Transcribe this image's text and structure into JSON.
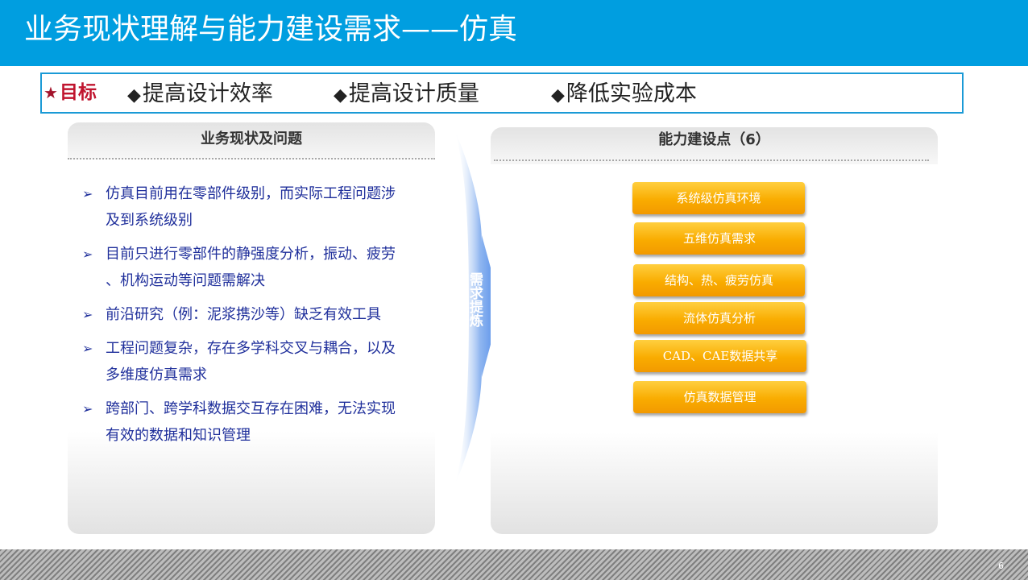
{
  "slide": {
    "title": "业务现状理解与能力建设需求——仿真",
    "page_number": "6"
  },
  "goals": {
    "label": "目标",
    "items": [
      "提高设计效率",
      "提高设计质量",
      "降低实验成本"
    ]
  },
  "left_panel": {
    "title": "业务现状及问题",
    "issues": [
      [
        "仿真目前用在零部件级别，而实际工程问题涉",
        "及到系统级别"
      ],
      [
        "目前只进行零部件的静强度分析，振动、疲劳",
        "、机构运动等问题需解决"
      ],
      [
        "前沿研究（例：泥浆携沙等）缺乏有效工具"
      ],
      [
        "工程问题复杂，存在多学科交叉与耦合，以及",
        "多维度仿真需求"
      ],
      [
        "跨部门、跨学科数据交互存在困难，无法实现",
        "有效的数据和知识管理"
      ]
    ]
  },
  "arrow": {
    "label": "需求提炼"
  },
  "right_panel": {
    "title": "能力建设点（6）",
    "capabilities": [
      "系统级仿真环境",
      "五维仿真需求",
      "结构、热、疲劳仿真",
      "流体仿真分析",
      "CAD、CAE数据共享",
      "仿真数据管理"
    ]
  },
  "colors": {
    "title_bar": "#009ee0",
    "goal_border": "#1a9ad6",
    "goal_label": "#c0142e",
    "issue_text": "#1f2f9b",
    "capability_fill": "#f9ac00",
    "arrow": "#4a86e8"
  },
  "icons": {
    "goal_marker": "star-icon",
    "goal_bullet": "diamond-icon",
    "issue_bullet": "arrowhead-icon"
  }
}
